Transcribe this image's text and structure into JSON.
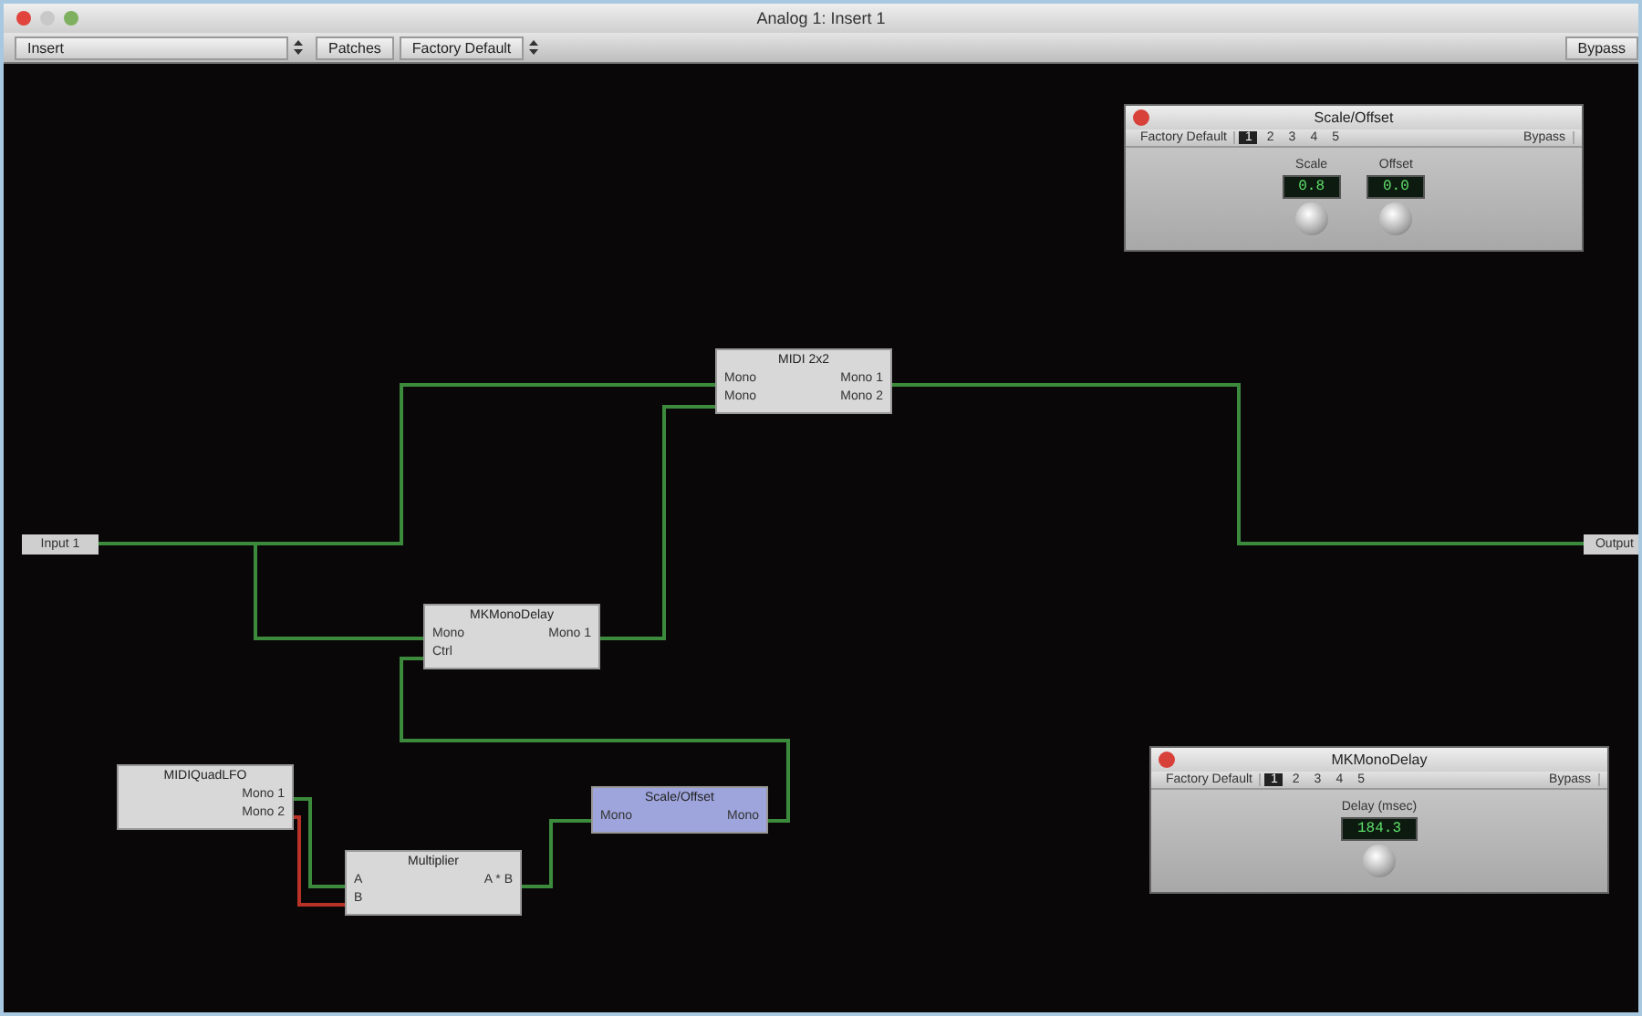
{
  "window": {
    "title": "Analog 1: Insert 1"
  },
  "toolbar": {
    "insert_menu": "Insert",
    "patches": "Patches",
    "preset": "Factory Default",
    "bypass": "Bypass"
  },
  "endpoints": [
    {
      "label": "Input 1"
    },
    {
      "label": "Output"
    }
  ],
  "nodes": [
    {
      "title": "MIDI 2x2",
      "inputs": [
        "Mono",
        "Mono"
      ],
      "outputs": [
        "Mono 1",
        "Mono 2"
      ],
      "selected": false
    },
    {
      "title": "MKMonoDelay",
      "inputs": [
        "Mono",
        "Ctrl"
      ],
      "outputs": [
        "Mono 1"
      ],
      "selected": false
    },
    {
      "title": "MIDIQuadLFO",
      "outputs": [
        "Mono 1",
        "Mono 2"
      ],
      "selected": false
    },
    {
      "title": "Multiplier",
      "inputs": [
        "A",
        "B"
      ],
      "outputs": [
        "A * B"
      ],
      "selected": false
    },
    {
      "title": "Scale/Offset",
      "inputs": [
        "Mono"
      ],
      "outputs": [
        "Mono"
      ],
      "selected": true
    }
  ],
  "wires": [
    {
      "color": "#3c8a3c"
    },
    {
      "color": "#3c8a3c"
    },
    {
      "color": "#3c8a3c"
    },
    {
      "color": "#3c8a3c"
    },
    {
      "color": "#3c8a3c"
    },
    {
      "color": "#3c8a3c"
    },
    {
      "color": "#3c8a3c"
    },
    {
      "color": "#b83228"
    }
  ],
  "panels": [
    {
      "title": "Scale/Offset",
      "preset": "Factory Default",
      "slots": [
        {
          "label": "1",
          "selected": true
        },
        {
          "label": "2",
          "selected": false
        },
        {
          "label": "3",
          "selected": false
        },
        {
          "label": "4",
          "selected": false
        },
        {
          "label": "5",
          "selected": false
        }
      ],
      "bypass": "Bypass",
      "params": [
        {
          "label": "Scale",
          "value": "0.8"
        },
        {
          "label": "Offset",
          "value": "0.0"
        }
      ]
    },
    {
      "title": "MKMonoDelay",
      "preset": "Factory Default",
      "slots": [
        {
          "label": "1",
          "selected": true
        },
        {
          "label": "2",
          "selected": false
        },
        {
          "label": "3",
          "selected": false
        },
        {
          "label": "4",
          "selected": false
        },
        {
          "label": "5",
          "selected": false
        }
      ],
      "bypass": "Bypass",
      "params": [
        {
          "label": "Delay (msec)",
          "value": "184.3"
        }
      ]
    }
  ]
}
